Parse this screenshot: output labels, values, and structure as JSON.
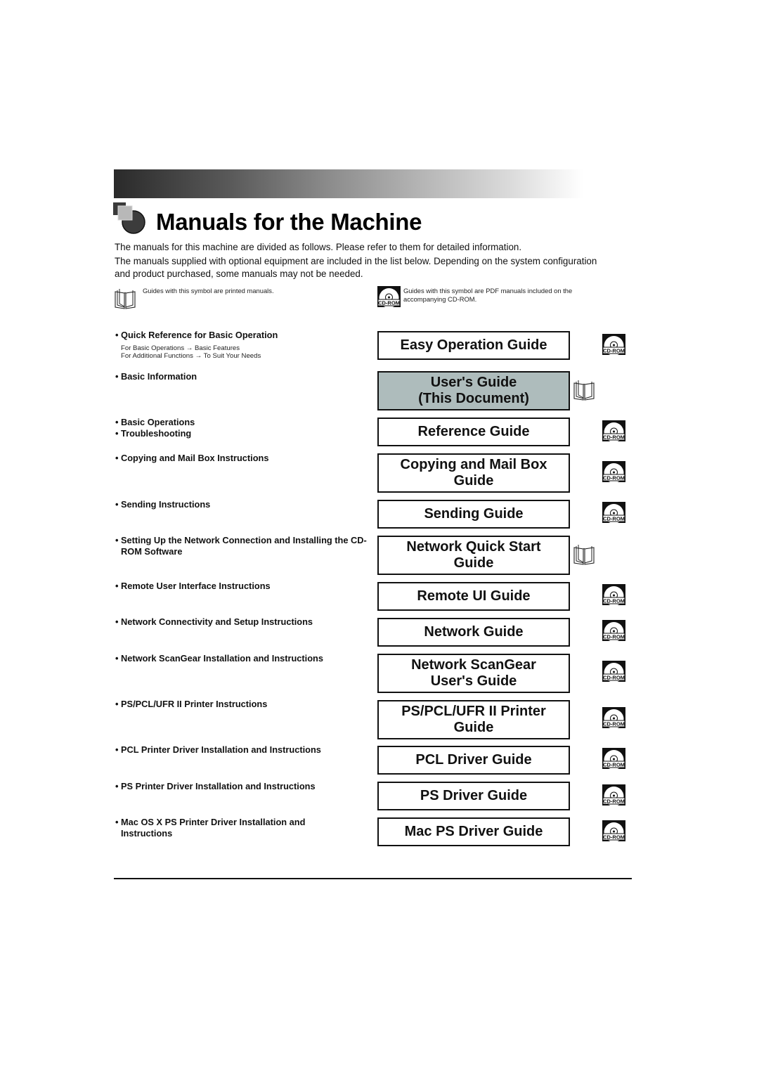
{
  "page": {
    "title": "Manuals for the Machine",
    "intro": [
      "The manuals for this machine are divided as follows. Please refer to them for detailed information.",
      "The manuals supplied with optional equipment are included in the list below. Depending on the system configuration and product purchased, some manuals may not be needed."
    ]
  },
  "legend": {
    "printed": {
      "icon": "printed-manual-book-icon",
      "text": "Guides with this symbol are printed manuals."
    },
    "cdrom": {
      "icon": "cd-rom-icon",
      "icon_label": "CD-ROM",
      "text": "Guides with this symbol are PDF manuals included on the accompanying CD-ROM."
    }
  },
  "left_items": [
    {
      "bullet": "•",
      "label": "Quick Reference for Basic Operation",
      "sub": [
        "For Basic Operations → Basic Features",
        "For Additional Functions → To Suit Your Needs"
      ]
    },
    {
      "bullet": "•",
      "label": "Basic Information"
    },
    {
      "bullet": "•",
      "label": "Basic Operations"
    },
    {
      "bullet": "•",
      "label": "Troubleshooting"
    },
    {
      "bullet": "•",
      "label": "Copying and Mail Box Instructions"
    },
    {
      "bullet": "•",
      "label": "Sending Instructions"
    },
    {
      "bullet": "•",
      "label": "Setting Up the Network Connection and Installing the CD-ROM Software"
    },
    {
      "bullet": "•",
      "label": "Remote User Interface Instructions"
    },
    {
      "bullet": "•",
      "label": "Network Connectivity and Setup Instructions"
    },
    {
      "bullet": "•",
      "label": "Network ScanGear Installation and Instructions"
    },
    {
      "bullet": "•",
      "label": "PS/PCL/UFR II Printer Instructions"
    },
    {
      "bullet": "•",
      "label": "PCL Printer Driver Installation and Instructions"
    },
    {
      "bullet": "•",
      "label": "PS Printer Driver Installation and Instructions"
    },
    {
      "bullet": "•",
      "label": "Mac OS X PS Printer Driver Installation and Instructions"
    }
  ],
  "guides": [
    {
      "line1": "Easy Operation Guide",
      "line2": "",
      "media": "cd-rom",
      "current": false
    },
    {
      "line1": "User's Guide",
      "line2": "(This Document)",
      "media": "printed",
      "current": true
    },
    {
      "line1": "Reference Guide",
      "line2": "",
      "media": "cd-rom",
      "current": false
    },
    {
      "line1": "Copying and Mail Box",
      "line2": "Guide",
      "media": "cd-rom",
      "current": false
    },
    {
      "line1": "Sending Guide",
      "line2": "",
      "media": "cd-rom",
      "current": false
    },
    {
      "line1": "Network Quick Start",
      "line2": "Guide",
      "media": "printed",
      "current": false
    },
    {
      "line1": "Remote UI Guide",
      "line2": "",
      "media": "cd-rom",
      "current": false
    },
    {
      "line1": "Network Guide",
      "line2": "",
      "media": "cd-rom",
      "current": false
    },
    {
      "line1": "Network ScanGear",
      "line2": "User's Guide",
      "media": "cd-rom",
      "current": false
    },
    {
      "line1": "PS/PCL/UFR II Printer",
      "line2": "Guide",
      "media": "cd-rom",
      "current": false
    },
    {
      "line1": "PCL Driver Guide",
      "line2": "",
      "media": "cd-rom",
      "current": false
    },
    {
      "line1": "PS Driver Guide",
      "line2": "",
      "media": "cd-rom",
      "current": false
    },
    {
      "line1": "Mac PS Driver Guide",
      "line2": "",
      "media": "cd-rom",
      "current": false
    }
  ],
  "colors": {
    "current_guide_fill": "#aebcbc",
    "border": "#111111"
  }
}
